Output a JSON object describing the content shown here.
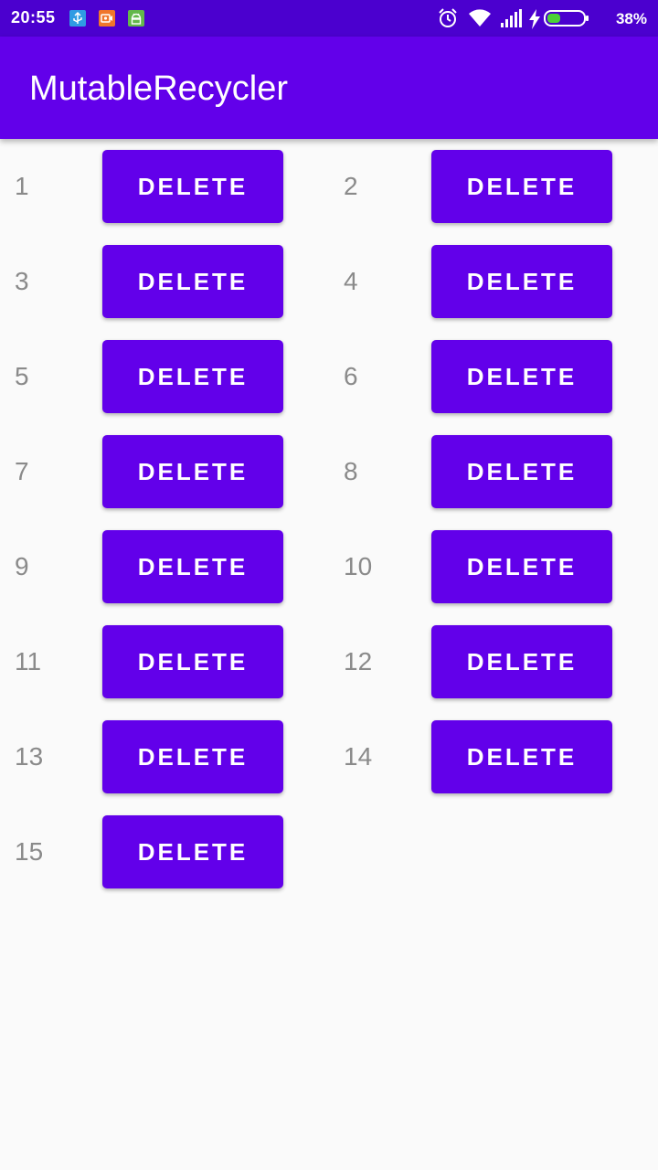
{
  "status_bar": {
    "time": "20:55",
    "battery_percent": "38%",
    "notification_icons": [
      "usb-icon",
      "screen-record-icon",
      "android-icon"
    ],
    "system_icons": [
      "alarm-icon",
      "wifi-icon",
      "cell-signal-icon",
      "charging-icon",
      "battery-icon"
    ],
    "battery_level": 0.38
  },
  "app_bar": {
    "title": "MutableRecycler"
  },
  "colors": {
    "status_bar": "#4b00cf",
    "primary": "#6200ea",
    "background": "#fafafa",
    "number_text": "#8a8a8a",
    "battery_fill": "#4cd137"
  },
  "items": [
    {
      "number": "1",
      "button": "DELETE"
    },
    {
      "number": "2",
      "button": "DELETE"
    },
    {
      "number": "3",
      "button": "DELETE"
    },
    {
      "number": "4",
      "button": "DELETE"
    },
    {
      "number": "5",
      "button": "DELETE"
    },
    {
      "number": "6",
      "button": "DELETE"
    },
    {
      "number": "7",
      "button": "DELETE"
    },
    {
      "number": "8",
      "button": "DELETE"
    },
    {
      "number": "9",
      "button": "DELETE"
    },
    {
      "number": "10",
      "button": "DELETE"
    },
    {
      "number": "11",
      "button": "DELETE"
    },
    {
      "number": "12",
      "button": "DELETE"
    },
    {
      "number": "13",
      "button": "DELETE"
    },
    {
      "number": "14",
      "button": "DELETE"
    },
    {
      "number": "15",
      "button": "DELETE"
    }
  ]
}
